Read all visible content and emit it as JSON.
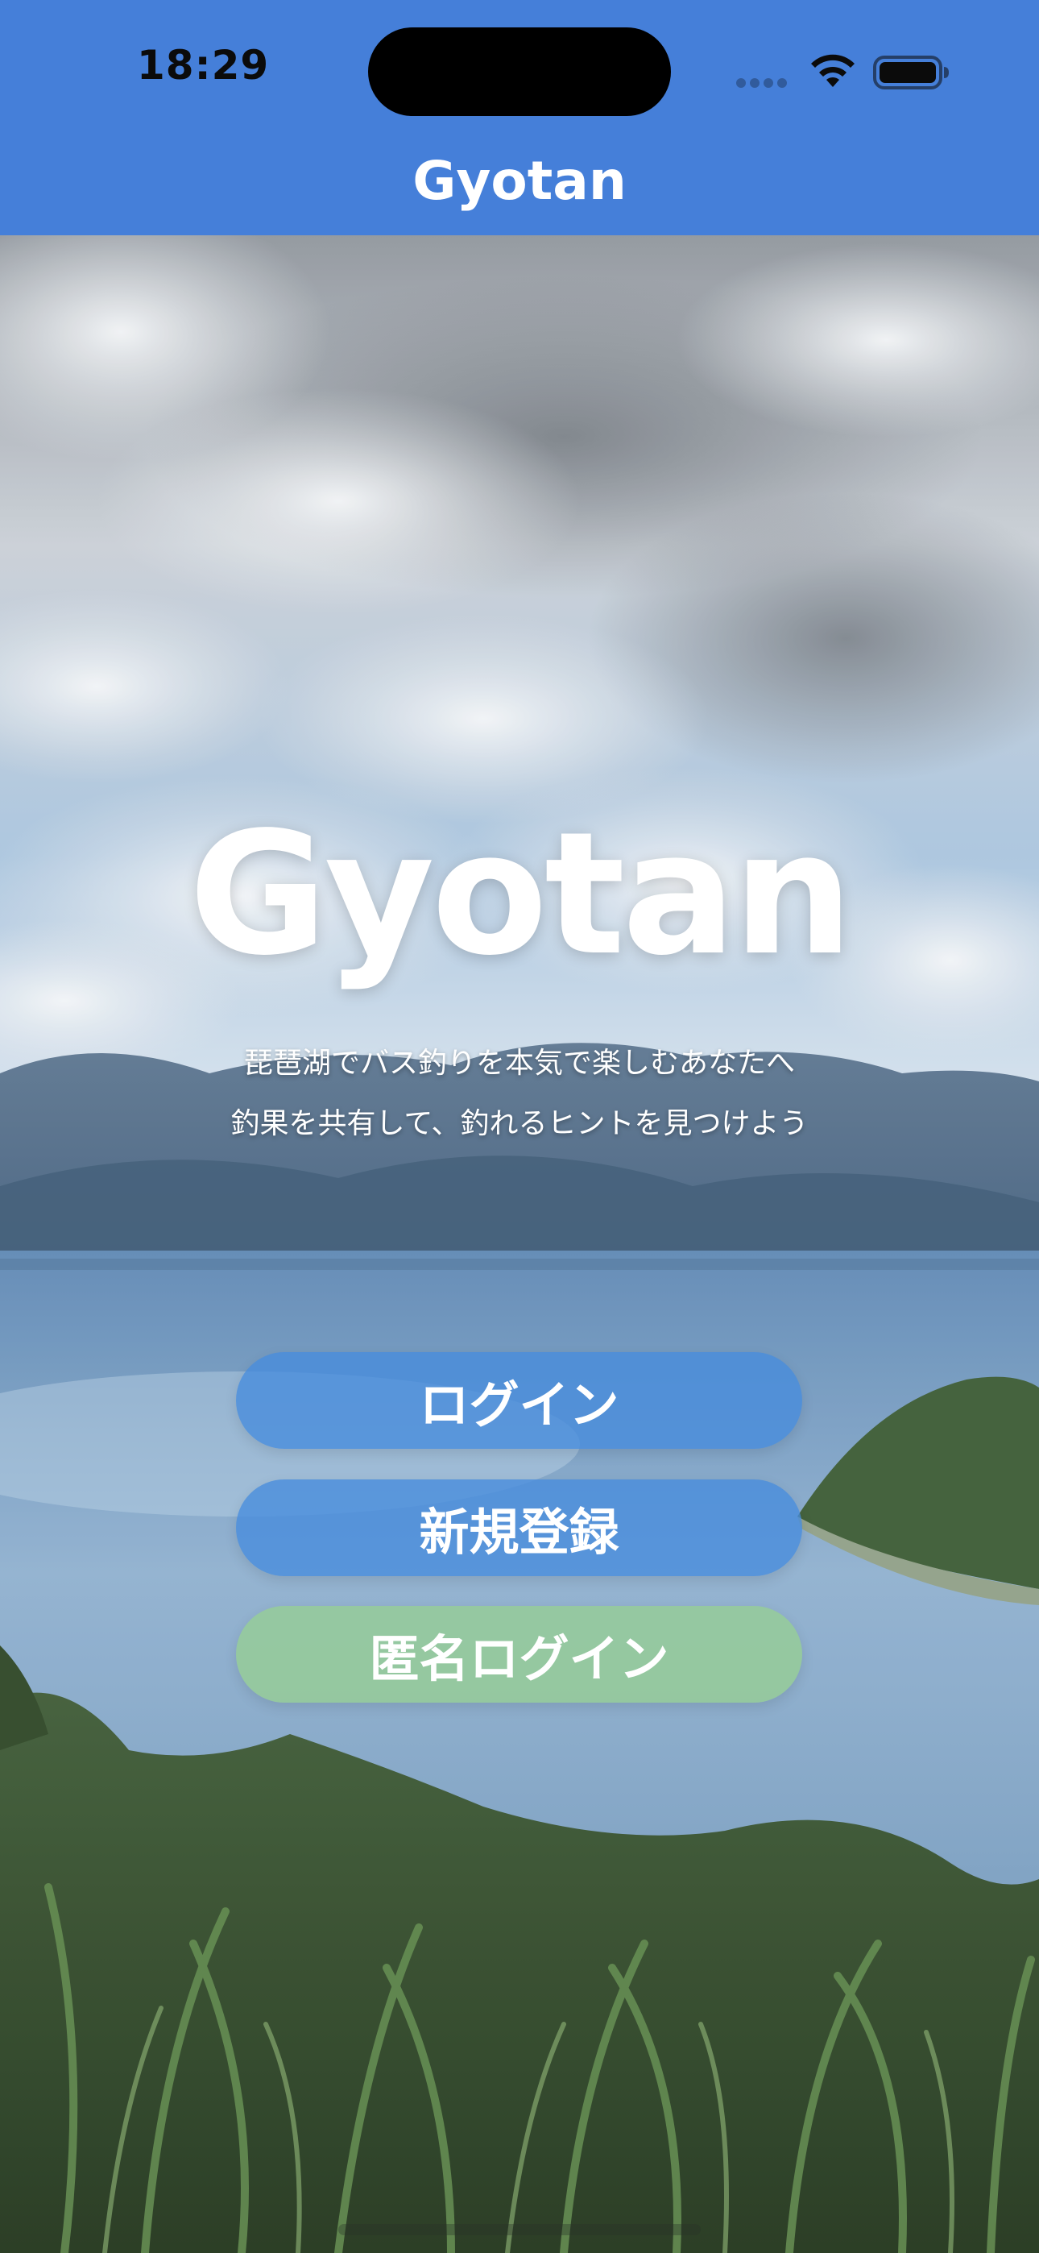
{
  "status_bar": {
    "time": "18:29",
    "icons": [
      "cellular-signal-icon",
      "wifi-icon",
      "battery-icon"
    ]
  },
  "nav": {
    "title": "Gyotan"
  },
  "hero": {
    "title": "Gyotan",
    "tagline_line1": "琵琶湖でバス釣りを本気で楽しむあなたへ",
    "tagline_line2": "釣果を共有して、釣れるヒントを見つけよう",
    "background": "lake-landscape-photo"
  },
  "actions": {
    "login": "ログイン",
    "register": "新規登録",
    "anonymous_login": "匿名ログイン"
  },
  "colors": {
    "nav_bar": "#457fd9",
    "primary_button": "#468cdc",
    "anonymous_button": "#96cd96",
    "text": "#ffffff"
  }
}
